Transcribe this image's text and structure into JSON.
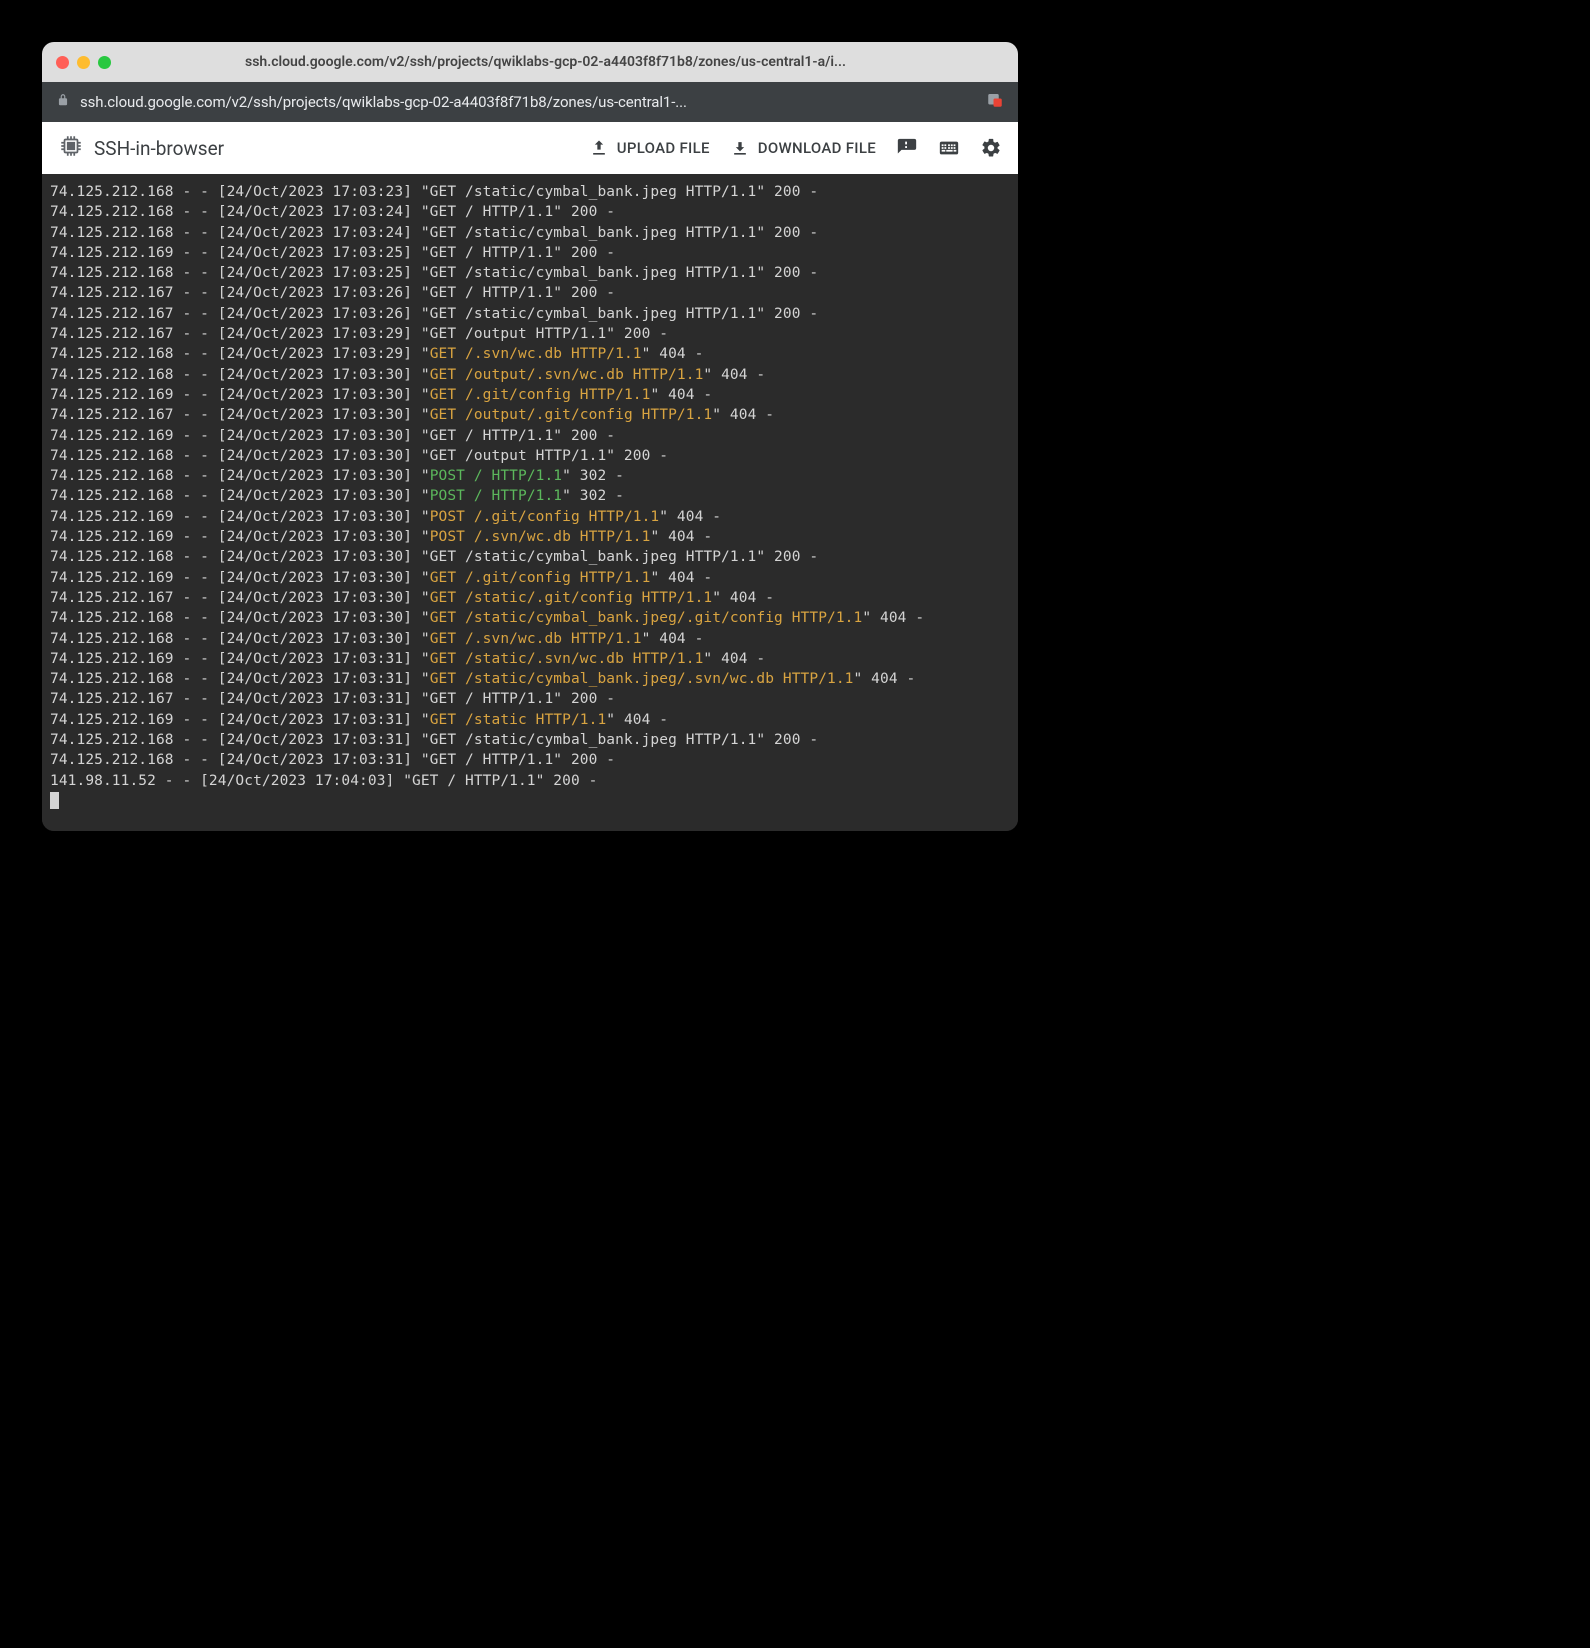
{
  "window": {
    "title": "ssh.cloud.google.com/v2/ssh/projects/qwiklabs-gcp-02-a4403f8f71b8/zones/us-central1-a/i...",
    "url": "ssh.cloud.google.com/v2/ssh/projects/qwiklabs-gcp-02-a4403f8f71b8/zones/us-central1-..."
  },
  "toolbar": {
    "brand": "SSH-in-browser",
    "upload": "UPLOAD FILE",
    "download": "DOWNLOAD FILE"
  },
  "log_lines": [
    {
      "pre": "74.125.212.168 - - [24/Oct/2023 17:03:23] \"GET /static/cymbal_bank.jpeg HTTP/1.1\" 200 -"
    },
    {
      "pre": "74.125.212.168 - - [24/Oct/2023 17:03:24] \"GET / HTTP/1.1\" 200 -"
    },
    {
      "pre": "74.125.212.168 - - [24/Oct/2023 17:03:24] \"GET /static/cymbal_bank.jpeg HTTP/1.1\" 200 -"
    },
    {
      "pre": "74.125.212.169 - - [24/Oct/2023 17:03:25] \"GET / HTTP/1.1\" 200 -"
    },
    {
      "pre": "74.125.212.168 - - [24/Oct/2023 17:03:25] \"GET /static/cymbal_bank.jpeg HTTP/1.1\" 200 -"
    },
    {
      "pre": "74.125.212.167 - - [24/Oct/2023 17:03:26] \"GET / HTTP/1.1\" 200 -"
    },
    {
      "pre": "74.125.212.167 - - [24/Oct/2023 17:03:26] \"GET /static/cymbal_bank.jpeg HTTP/1.1\" 200 -"
    },
    {
      "pre": "74.125.212.167 - - [24/Oct/2023 17:03:29] \"GET /output HTTP/1.1\" 200 -"
    },
    {
      "pre": "74.125.212.168 - - [24/Oct/2023 17:03:29] \"",
      "hl": "GET /.svn/wc.db HTTP/1.1",
      "post": "\" 404 -"
    },
    {
      "pre": "74.125.212.168 - - [24/Oct/2023 17:03:30] \"",
      "hl": "GET /output/.svn/wc.db HTTP/1.1",
      "post": "\" 404 -"
    },
    {
      "pre": "74.125.212.169 - - [24/Oct/2023 17:03:30] \"",
      "hl": "GET /.git/config HTTP/1.1",
      "post": "\" 404 -"
    },
    {
      "pre": "74.125.212.167 - - [24/Oct/2023 17:03:30] \"",
      "hl": "GET /output/.git/config HTTP/1.1",
      "post": "\" 404 -"
    },
    {
      "pre": "74.125.212.169 - - [24/Oct/2023 17:03:30] \"GET / HTTP/1.1\" 200 -"
    },
    {
      "pre": "74.125.212.168 - - [24/Oct/2023 17:03:30] \"GET /output HTTP/1.1\" 200 -"
    },
    {
      "pre": "74.125.212.168 - - [24/Oct/2023 17:03:30] \"",
      "gr": "POST / HTTP/1.1",
      "post": "\" 302 -"
    },
    {
      "pre": "74.125.212.168 - - [24/Oct/2023 17:03:30] \"",
      "gr": "POST / HTTP/1.1",
      "post": "\" 302 -"
    },
    {
      "pre": "74.125.212.169 - - [24/Oct/2023 17:03:30] \"",
      "hl": "POST /.git/config HTTP/1.1",
      "post": "\" 404 -"
    },
    {
      "pre": "74.125.212.169 - - [24/Oct/2023 17:03:30] \"",
      "hl": "POST /.svn/wc.db HTTP/1.1",
      "post": "\" 404 -"
    },
    {
      "pre": "74.125.212.168 - - [24/Oct/2023 17:03:30] \"GET /static/cymbal_bank.jpeg HTTP/1.1\" 200 -"
    },
    {
      "pre": "74.125.212.169 - - [24/Oct/2023 17:03:30] \"",
      "hl": "GET /.git/config HTTP/1.1",
      "post": "\" 404 -"
    },
    {
      "pre": "74.125.212.167 - - [24/Oct/2023 17:03:30] \"",
      "hl": "GET /static/.git/config HTTP/1.1",
      "post": "\" 404 -"
    },
    {
      "pre": "74.125.212.168 - - [24/Oct/2023 17:03:30] \"",
      "hl": "GET /static/cymbal_bank.jpeg/.git/config HTTP/1.1",
      "post": "\" 404 -"
    },
    {
      "pre": "74.125.212.168 - - [24/Oct/2023 17:03:30] \"",
      "hl": "GET /.svn/wc.db HTTP/1.1",
      "post": "\" 404 -"
    },
    {
      "pre": "74.125.212.169 - - [24/Oct/2023 17:03:31] \"",
      "hl": "GET /static/.svn/wc.db HTTP/1.1",
      "post": "\" 404 -"
    },
    {
      "pre": "74.125.212.168 - - [24/Oct/2023 17:03:31] \"",
      "hl": "GET /static/cymbal_bank.jpeg/.svn/wc.db HTTP/1.1",
      "post": "\" 404 -"
    },
    {
      "pre": "74.125.212.167 - - [24/Oct/2023 17:03:31] \"GET / HTTP/1.1\" 200 -"
    },
    {
      "pre": "74.125.212.169 - - [24/Oct/2023 17:03:31] \"",
      "hl": "GET /static HTTP/1.1",
      "post": "\" 404 -"
    },
    {
      "pre": "74.125.212.168 - - [24/Oct/2023 17:03:31] \"GET /static/cymbal_bank.jpeg HTTP/1.1\" 200 -"
    },
    {
      "pre": "74.125.212.168 - - [24/Oct/2023 17:03:31] \"GET / HTTP/1.1\" 200 -"
    },
    {
      "pre": "141.98.11.52 - - [24/Oct/2023 17:04:03] \"GET / HTTP/1.1\" 200 -"
    }
  ]
}
